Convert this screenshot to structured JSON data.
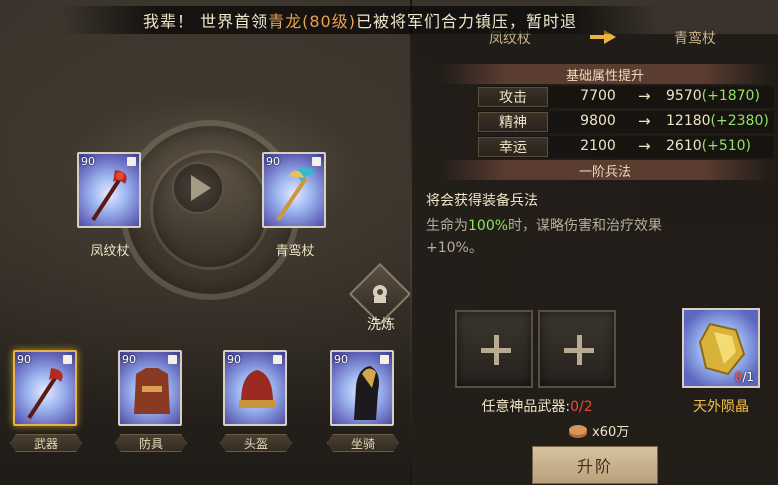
{
  "banner": {
    "prefix": "我辈！ 世界首领",
    "boss": "青龙(80级)",
    "suffix": "已被将军们合力镇压，暂时退"
  },
  "forge": {
    "from_item": {
      "level": "90",
      "name": "凤纹杖"
    },
    "to_item": {
      "level": "90",
      "name": "青鸾杖"
    },
    "wash_label": "洗炼"
  },
  "equipment": [
    {
      "level": "90",
      "label": "武器",
      "selected": true
    },
    {
      "level": "90",
      "label": "防具",
      "selected": false
    },
    {
      "level": "90",
      "label": "头盔",
      "selected": false
    },
    {
      "level": "90",
      "label": "坐骑",
      "selected": false
    }
  ],
  "right": {
    "from_name": "凤纹杖",
    "to_name": "青鸾杖",
    "stats_title": "基础属性提升",
    "stats": [
      {
        "label": "攻击",
        "current": "7700",
        "arrow": "→",
        "new": "9570",
        "gain": "(+1870)"
      },
      {
        "label": "精神",
        "current": "9800",
        "arrow": "→",
        "new": "12180",
        "gain": "(+2380)"
      },
      {
        "label": "幸运",
        "current": "2100",
        "arrow": "→",
        "new": "2610",
        "gain": "(+510)"
      }
    ],
    "art_section": "一阶兵法",
    "art_title": "将会获得装备兵法",
    "art_desc_1": "生命为",
    "art_desc_pct": "100%",
    "art_desc_2": "时，谋略伤害和治疗效果",
    "art_desc_3": "+10%。",
    "slot_label_text": "任意神品武器:",
    "slot_label_count": "0/2",
    "crystal_count_have": "0",
    "crystal_count_need": "/1",
    "crystal_name": "天外陨晶",
    "cost_text": "x60万",
    "upgrade_label": "升阶"
  }
}
